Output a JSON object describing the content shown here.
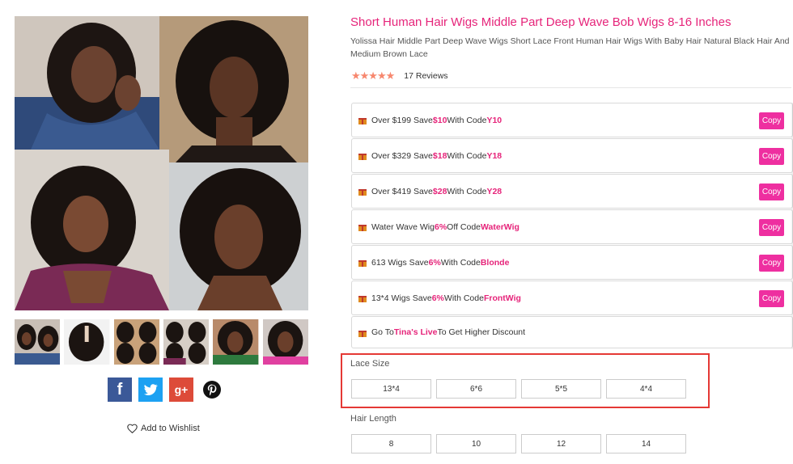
{
  "product": {
    "title": "Short Human Hair Wigs Middle Part Deep Wave Bob Wigs 8-16 Inches",
    "subtitle": "Yolissa Hair Middle Part Deep Wave Wigs Short Lace Front Human Hair Wigs With Baby Hair Natural Black Hair And Medium Brown Lace",
    "stars": "★★★★★",
    "rating_value": 5,
    "reviews": "17 Reviews"
  },
  "coupons": [
    {
      "pre": "Over $199 Save ",
      "amount": "$10",
      "mid": " With Code ",
      "code": "Y10",
      "copy": "Copy"
    },
    {
      "pre": "Over $329 Save ",
      "amount": "$18",
      "mid": " With Code ",
      "code": "Y18",
      "copy": "Copy"
    },
    {
      "pre": "Over $419 Save ",
      "amount": "$28",
      "mid": " With Code ",
      "code": "Y28",
      "copy": "Copy"
    },
    {
      "pre": "Water Wave Wig ",
      "amount": "6%",
      "mid": " Off Code ",
      "code": "WaterWig",
      "copy": "Copy"
    },
    {
      "pre": "613 Wigs Save ",
      "amount": "6%",
      "mid": " With Code ",
      "code": "Blonde",
      "copy": "Copy"
    },
    {
      "pre": "13*4 Wigs Save ",
      "amount": "6%",
      "mid": " With Code ",
      "code": "FrontWig",
      "copy": "Copy"
    }
  ],
  "live_promo": {
    "pre": "Go To ",
    "link": "Tina's Live",
    "post": " To Get Higher Discount"
  },
  "lace_size": {
    "label": "Lace Size",
    "options": [
      "13*4",
      "6*6",
      "5*5",
      "4*4"
    ]
  },
  "hair_length": {
    "label": "Hair Length",
    "options": [
      "8",
      "10",
      "12",
      "14"
    ]
  },
  "social": {
    "facebook": "f",
    "google_plus": "g+"
  },
  "wishlist": {
    "label": "Add to Wishlist"
  },
  "colors": {
    "accent": "#e6247a",
    "copy_button": "#ee2fa0",
    "highlight_border": "#e53935",
    "stars": "#f7876e"
  }
}
